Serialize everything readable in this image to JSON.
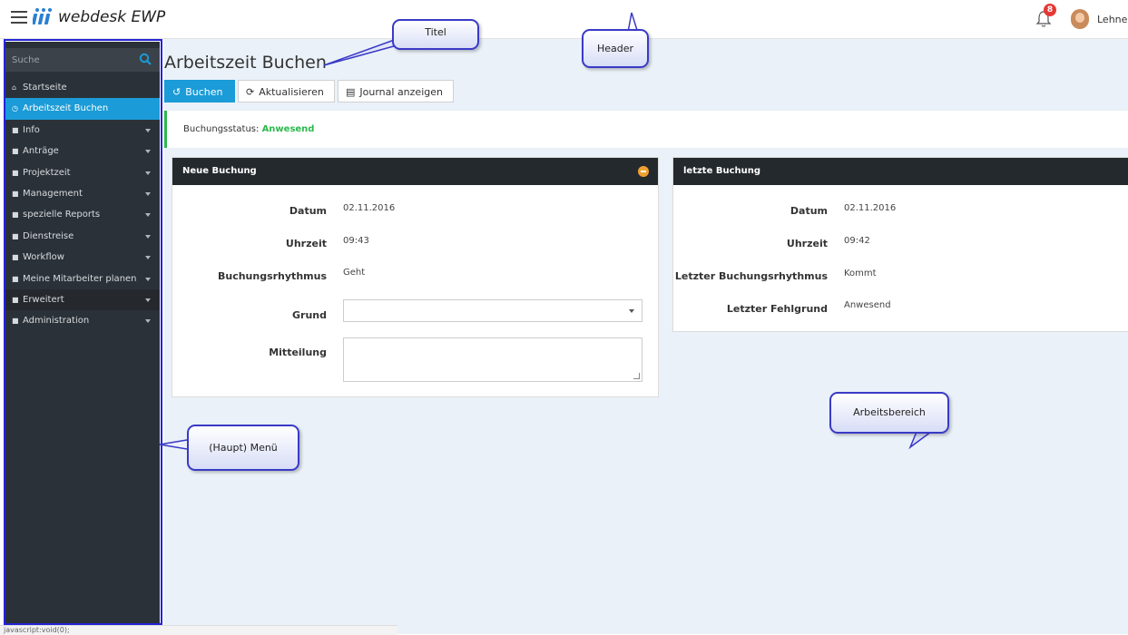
{
  "header": {
    "logo_text": "webdesk EWP",
    "notification_count": "8",
    "username": "Lehner"
  },
  "sidebar": {
    "search_label": "Suche",
    "items": [
      {
        "label": "Startseite",
        "icon": "home-icon",
        "active": false,
        "has_caret": false
      },
      {
        "label": "Arbeitszeit Buchen",
        "icon": "clock-icon",
        "active": true,
        "has_caret": false
      },
      {
        "label": "Info",
        "icon": "folder-icon",
        "active": false,
        "has_caret": true
      },
      {
        "label": "Anträge",
        "icon": "folder-icon",
        "active": false,
        "has_caret": true
      },
      {
        "label": "Projektzeit",
        "icon": "folder-icon",
        "active": false,
        "has_caret": true
      },
      {
        "label": "Management",
        "icon": "folder-icon",
        "active": false,
        "has_caret": true
      },
      {
        "label": "spezielle Reports",
        "icon": "folder-icon",
        "active": false,
        "has_caret": true
      },
      {
        "label": "Dienstreise",
        "icon": "folder-icon",
        "active": false,
        "has_caret": true
      },
      {
        "label": "Workflow",
        "icon": "folder-icon",
        "active": false,
        "has_caret": true
      },
      {
        "label": "Meine Mitarbeiter planen",
        "icon": "folder-icon",
        "active": false,
        "has_caret": true
      },
      {
        "label": "Erweitert",
        "icon": "folder-icon",
        "active": false,
        "has_caret": true
      },
      {
        "label": "Administration",
        "icon": "folder-icon",
        "active": false,
        "has_caret": true
      }
    ]
  },
  "status_url": "javascript:void(0);",
  "page": {
    "title": "Arbeitszeit Buchen",
    "toolbar": {
      "book_label": "Buchen",
      "refresh_label": "Aktualisieren",
      "journal_label": "Journal anzeigen"
    },
    "status": {
      "label": "Buchungsstatus:",
      "value": "Anwesend",
      "color": "#2bb94b"
    }
  },
  "new_booking": {
    "title": "Neue Buchung",
    "date_label": "Datum",
    "date_value": "02.11.2016",
    "time_label": "Uhrzeit",
    "time_value": "09:43",
    "rhythm_label": "Buchungsrhythmus",
    "rhythm_value": "Geht",
    "reason_label": "Grund",
    "reason_value": "",
    "message_label": "Mitteilung",
    "message_value": ""
  },
  "last_booking": {
    "title": "letzte Buchung",
    "date_label": "Datum",
    "date_value": "02.11.2016",
    "time_label": "Uhrzeit",
    "time_value": "09:42",
    "rhythm_label": "Letzter Buchungsrhythmus",
    "rhythm_value": "Kommt",
    "absence_label": "Letzter Fehlgrund",
    "absence_value": "Anwesend"
  },
  "callouts": {
    "title": "Titel",
    "header": "Header",
    "menu": "(Haupt) Menü",
    "workspace": "Arbeitsbereich"
  },
  "colors": {
    "accent": "#1b9bd7",
    "sidebar_bg": "#2b3138",
    "content_bg": "#eaf1f8",
    "annotation_border": "#2323d8"
  }
}
